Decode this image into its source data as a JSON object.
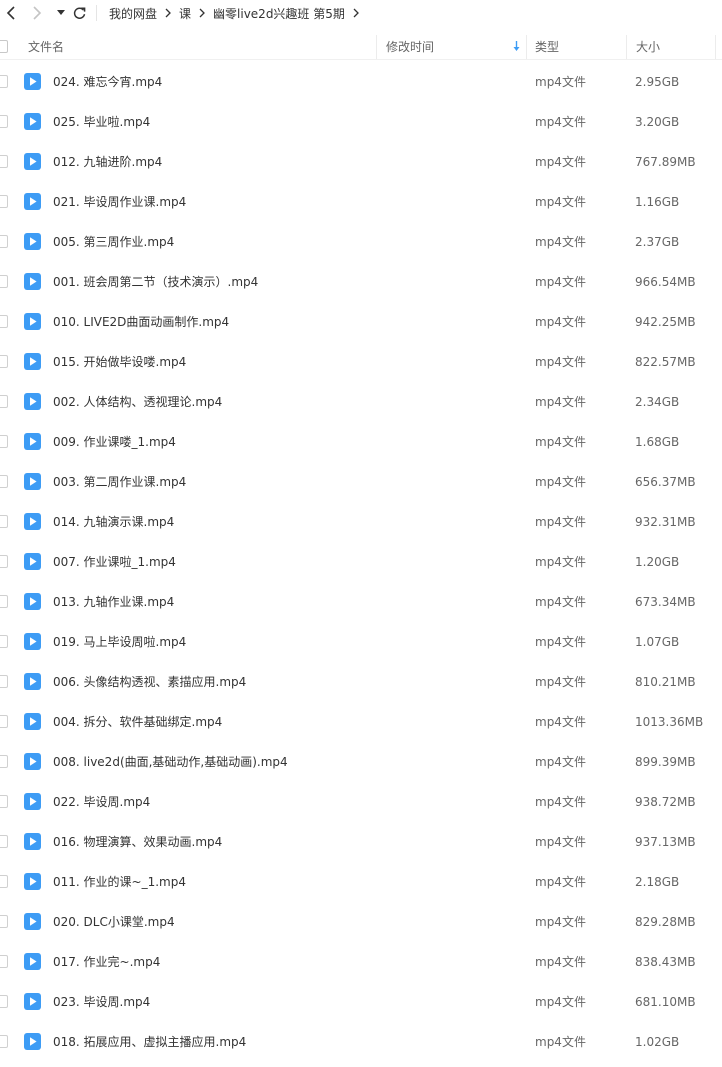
{
  "breadcrumb": [
    "我的网盘",
    "课",
    "幽零live2d兴趣班 第5期"
  ],
  "columns": {
    "name": "文件名",
    "mtime": "修改时间",
    "type": "类型",
    "size": "大小"
  },
  "icons": {
    "back": "chevron-left-icon",
    "forward": "chevron-right-icon",
    "history": "caret-down-icon",
    "refresh": "refresh-icon",
    "video": "video-file-icon",
    "sort": "sort-desc-icon"
  },
  "colors": {
    "video_icon": "#3d9cf5",
    "sort_arrow": "#3d9cf5"
  },
  "files": [
    {
      "name": "024. 难忘今宵.mp4",
      "type": "mp4文件",
      "size": "2.95GB"
    },
    {
      "name": "025. 毕业啦.mp4",
      "type": "mp4文件",
      "size": "3.20GB"
    },
    {
      "name": "012. 九轴进阶.mp4",
      "type": "mp4文件",
      "size": "767.89MB"
    },
    {
      "name": "021. 毕设周作业课.mp4",
      "type": "mp4文件",
      "size": "1.16GB"
    },
    {
      "name": "005. 第三周作业.mp4",
      "type": "mp4文件",
      "size": "2.37GB"
    },
    {
      "name": "001. 班会周第二节（技术演示）.mp4",
      "type": "mp4文件",
      "size": "966.54MB"
    },
    {
      "name": "010. LIVE2D曲面动画制作.mp4",
      "type": "mp4文件",
      "size": "942.25MB"
    },
    {
      "name": "015. 开始做毕设喽.mp4",
      "type": "mp4文件",
      "size": "822.57MB"
    },
    {
      "name": "002. 人体结构、透视理论.mp4",
      "type": "mp4文件",
      "size": "2.34GB"
    },
    {
      "name": "009. 作业课喽_1.mp4",
      "type": "mp4文件",
      "size": "1.68GB"
    },
    {
      "name": "003. 第二周作业课.mp4",
      "type": "mp4文件",
      "size": "656.37MB"
    },
    {
      "name": "014. 九轴演示课.mp4",
      "type": "mp4文件",
      "size": "932.31MB"
    },
    {
      "name": "007. 作业课啦_1.mp4",
      "type": "mp4文件",
      "size": "1.20GB"
    },
    {
      "name": "013. 九轴作业课.mp4",
      "type": "mp4文件",
      "size": "673.34MB"
    },
    {
      "name": "019. 马上毕设周啦.mp4",
      "type": "mp4文件",
      "size": "1.07GB"
    },
    {
      "name": "006. 头像结构透视、素描应用.mp4",
      "type": "mp4文件",
      "size": "810.21MB"
    },
    {
      "name": "004. 拆分、软件基础绑定.mp4",
      "type": "mp4文件",
      "size": "1013.36MB"
    },
    {
      "name": "008. live2d(曲面,基础动作,基础动画).mp4",
      "type": "mp4文件",
      "size": "899.39MB"
    },
    {
      "name": "022. 毕设周.mp4",
      "type": "mp4文件",
      "size": "938.72MB"
    },
    {
      "name": "016. 物理演算、效果动画.mp4",
      "type": "mp4文件",
      "size": "937.13MB"
    },
    {
      "name": "011. 作业的课~_1.mp4",
      "type": "mp4文件",
      "size": "2.18GB"
    },
    {
      "name": "020. DLC小课堂.mp4",
      "type": "mp4文件",
      "size": "829.28MB"
    },
    {
      "name": "017. 作业完~.mp4",
      "type": "mp4文件",
      "size": "838.43MB"
    },
    {
      "name": "023. 毕设周.mp4",
      "type": "mp4文件",
      "size": "681.10MB"
    },
    {
      "name": "018. 拓展应用、虚拟主播应用.mp4",
      "type": "mp4文件",
      "size": "1.02GB"
    }
  ]
}
